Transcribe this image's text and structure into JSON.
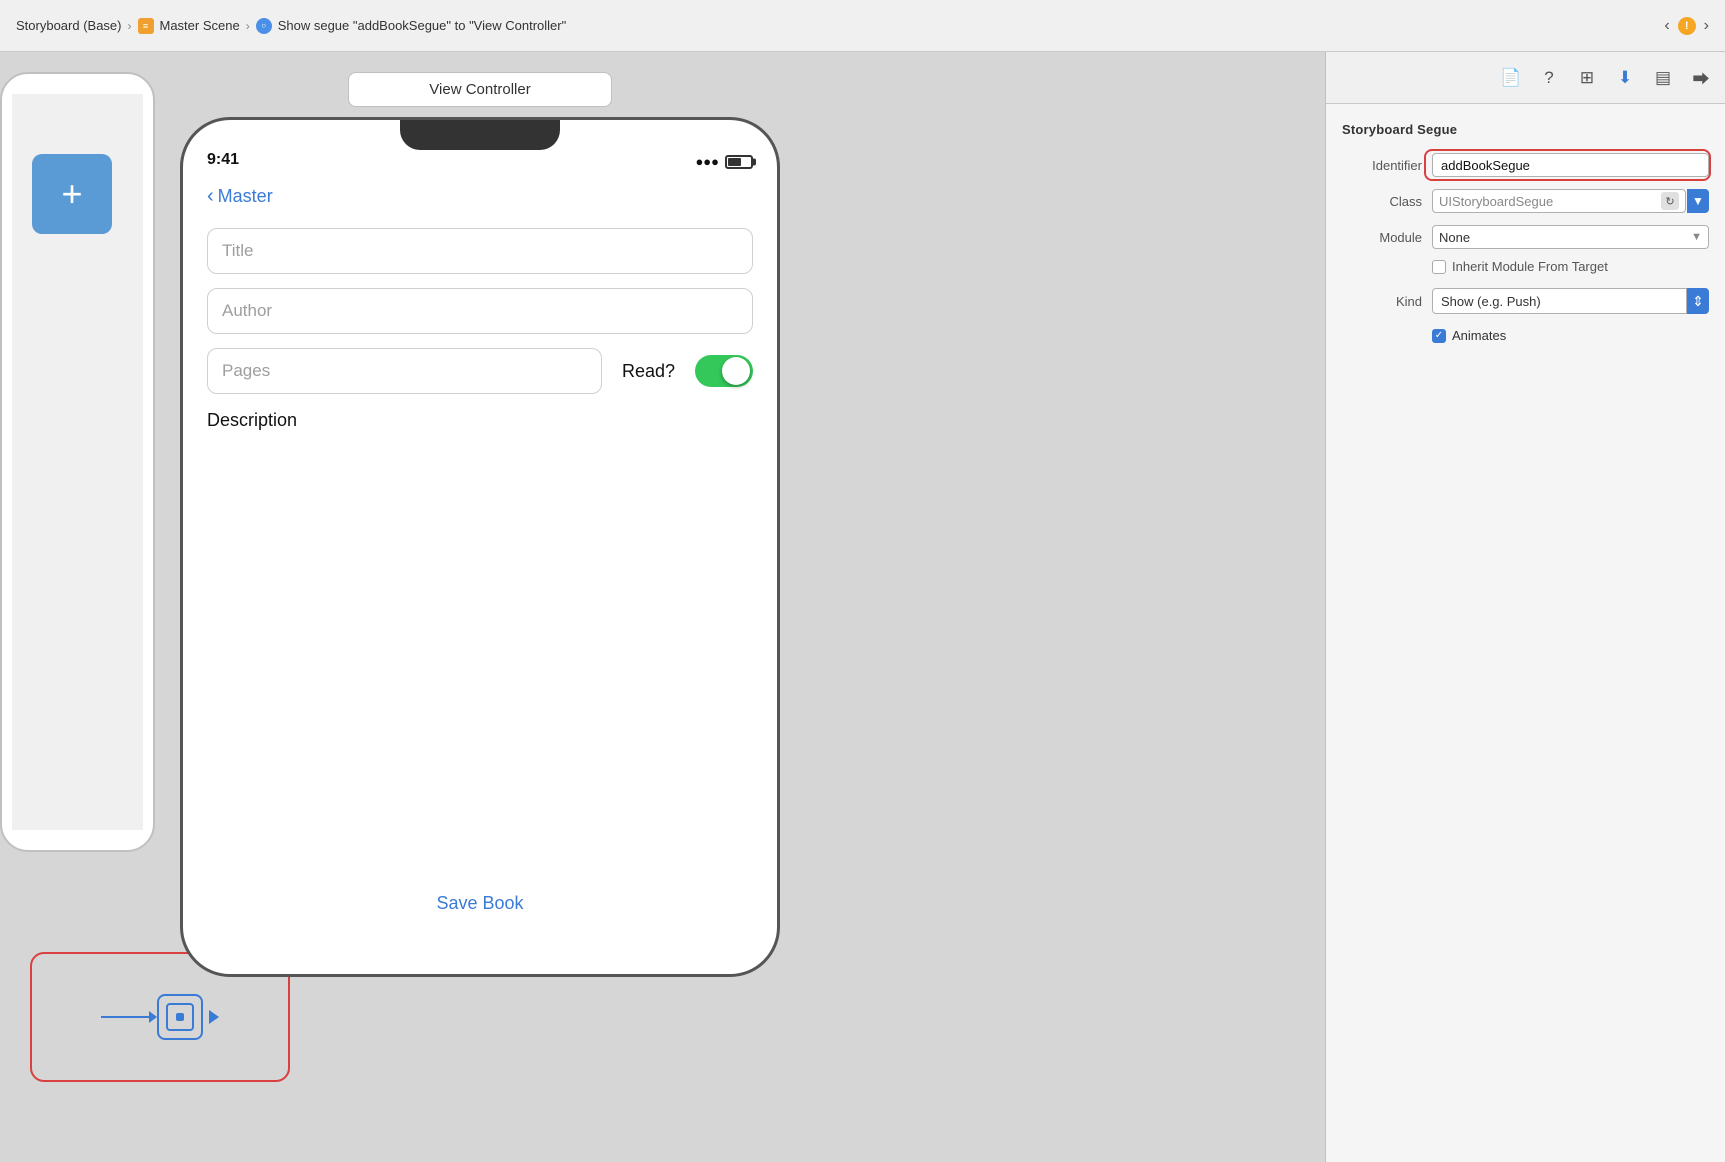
{
  "breadcrumb": {
    "parts": [
      "Storyboard (Base)",
      "Master Scene",
      "Show segue \"addBookSegue\" to \"View Controller\""
    ],
    "icons": [
      "storyboard",
      "scene",
      "segue"
    ]
  },
  "toolbar": {
    "icons": [
      "file",
      "question",
      "grid",
      "download",
      "sidebar",
      "forward"
    ]
  },
  "canvas": {
    "view_controller_label": "View Controller",
    "phone": {
      "time": "9:41",
      "back_label": "Master",
      "fields": {
        "title_placeholder": "Title",
        "author_placeholder": "Author",
        "pages_placeholder": "Pages",
        "read_label": "Read?",
        "description_label": "Description",
        "save_button_label": "Save Book"
      }
    }
  },
  "inspector": {
    "section_title": "Storyboard Segue",
    "identifier_label": "Identifier",
    "identifier_value": "addBookSegue",
    "class_label": "Class",
    "class_value": "UIStoryboardSegue",
    "module_label": "Module",
    "module_value": "None",
    "inherit_label": "Inherit Module From Target",
    "kind_label": "Kind",
    "kind_value": "Show (e.g. Push)",
    "animates_label": "Animates"
  },
  "segue": {
    "has_red_border": true
  }
}
